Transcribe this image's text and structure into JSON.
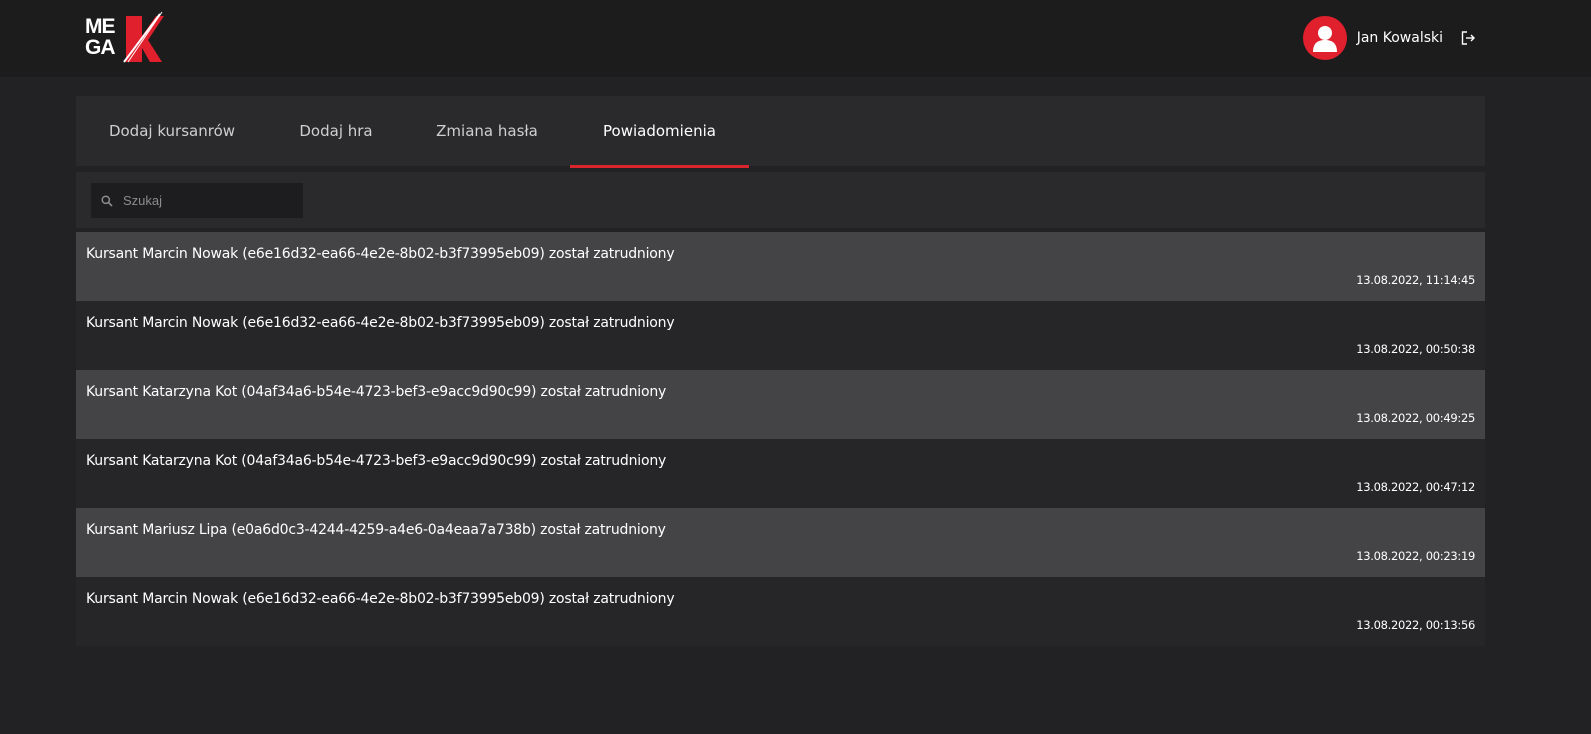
{
  "header": {
    "logo_line1": "ME",
    "logo_line2": "GA",
    "user_name": "Jan Kowalski",
    "icons": {
      "avatar": "user-icon",
      "logout": "logout-icon"
    }
  },
  "tabs": [
    {
      "label": "Dodaj kursanrów",
      "active": false
    },
    {
      "label": "Dodaj hra",
      "active": false
    },
    {
      "label": "Zmiana hasła",
      "active": false
    },
    {
      "label": "Powiadomienia",
      "active": true
    }
  ],
  "search": {
    "placeholder": "Szukaj",
    "value": "",
    "icon": "search-icon"
  },
  "notifications": [
    {
      "message": "Kursant Marcin Nowak (e6e16d32-ea66-4e2e-8b02-b3f73995eb09) został zatrudniony",
      "time": "13.08.2022, 11:14:45"
    },
    {
      "message": "Kursant Marcin Nowak (e6e16d32-ea66-4e2e-8b02-b3f73995eb09) został zatrudniony",
      "time": "13.08.2022, 00:50:38"
    },
    {
      "message": "Kursant Katarzyna Kot (04af34a6-b54e-4723-bef3-e9acc9d90c99) został zatrudniony",
      "time": "13.08.2022, 00:49:25"
    },
    {
      "message": "Kursant Katarzyna Kot (04af34a6-b54e-4723-bef3-e9acc9d90c99) został zatrudniony",
      "time": "13.08.2022, 00:47:12"
    },
    {
      "message": "Kursant Mariusz Lipa (e0a6d0c3-4244-4259-a4e6-0a4eaa7a738b) został zatrudniony",
      "time": "13.08.2022, 00:23:19"
    },
    {
      "message": "Kursant Marcin Nowak (e6e16d32-ea66-4e2e-8b02-b3f73995eb09) został zatrudniony",
      "time": "13.08.2022, 00:13:56"
    }
  ],
  "colors": {
    "accent": "#d8262c",
    "background": "#222224",
    "row_alt": "#444446",
    "row": "#262628"
  }
}
